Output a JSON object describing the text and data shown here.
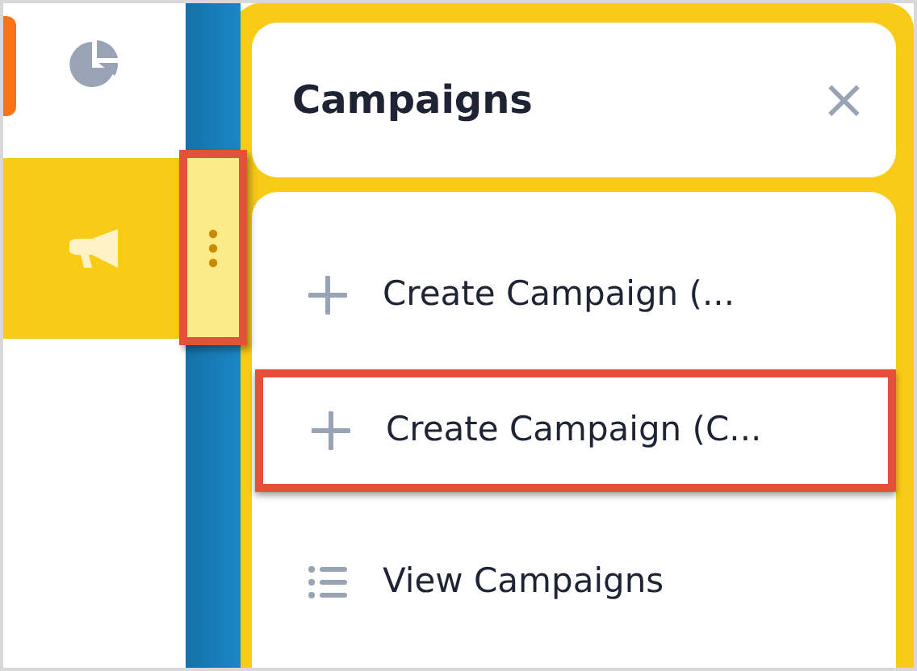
{
  "sidebar": {
    "items": [
      {
        "kind": "chart",
        "selected": true
      },
      {
        "kind": "campaign",
        "selected": false,
        "active_section": true
      }
    ]
  },
  "resize_handle": {
    "highlighted": true
  },
  "panel": {
    "title": "Campaigns",
    "close": "×",
    "items": [
      {
        "kind": "create",
        "label": "Create Campaign (...",
        "highlighted": false
      },
      {
        "kind": "create",
        "label": "Create Campaign (C...",
        "highlighted": true
      },
      {
        "kind": "list",
        "label": "View Campaigns",
        "highlighted": false
      }
    ]
  }
}
